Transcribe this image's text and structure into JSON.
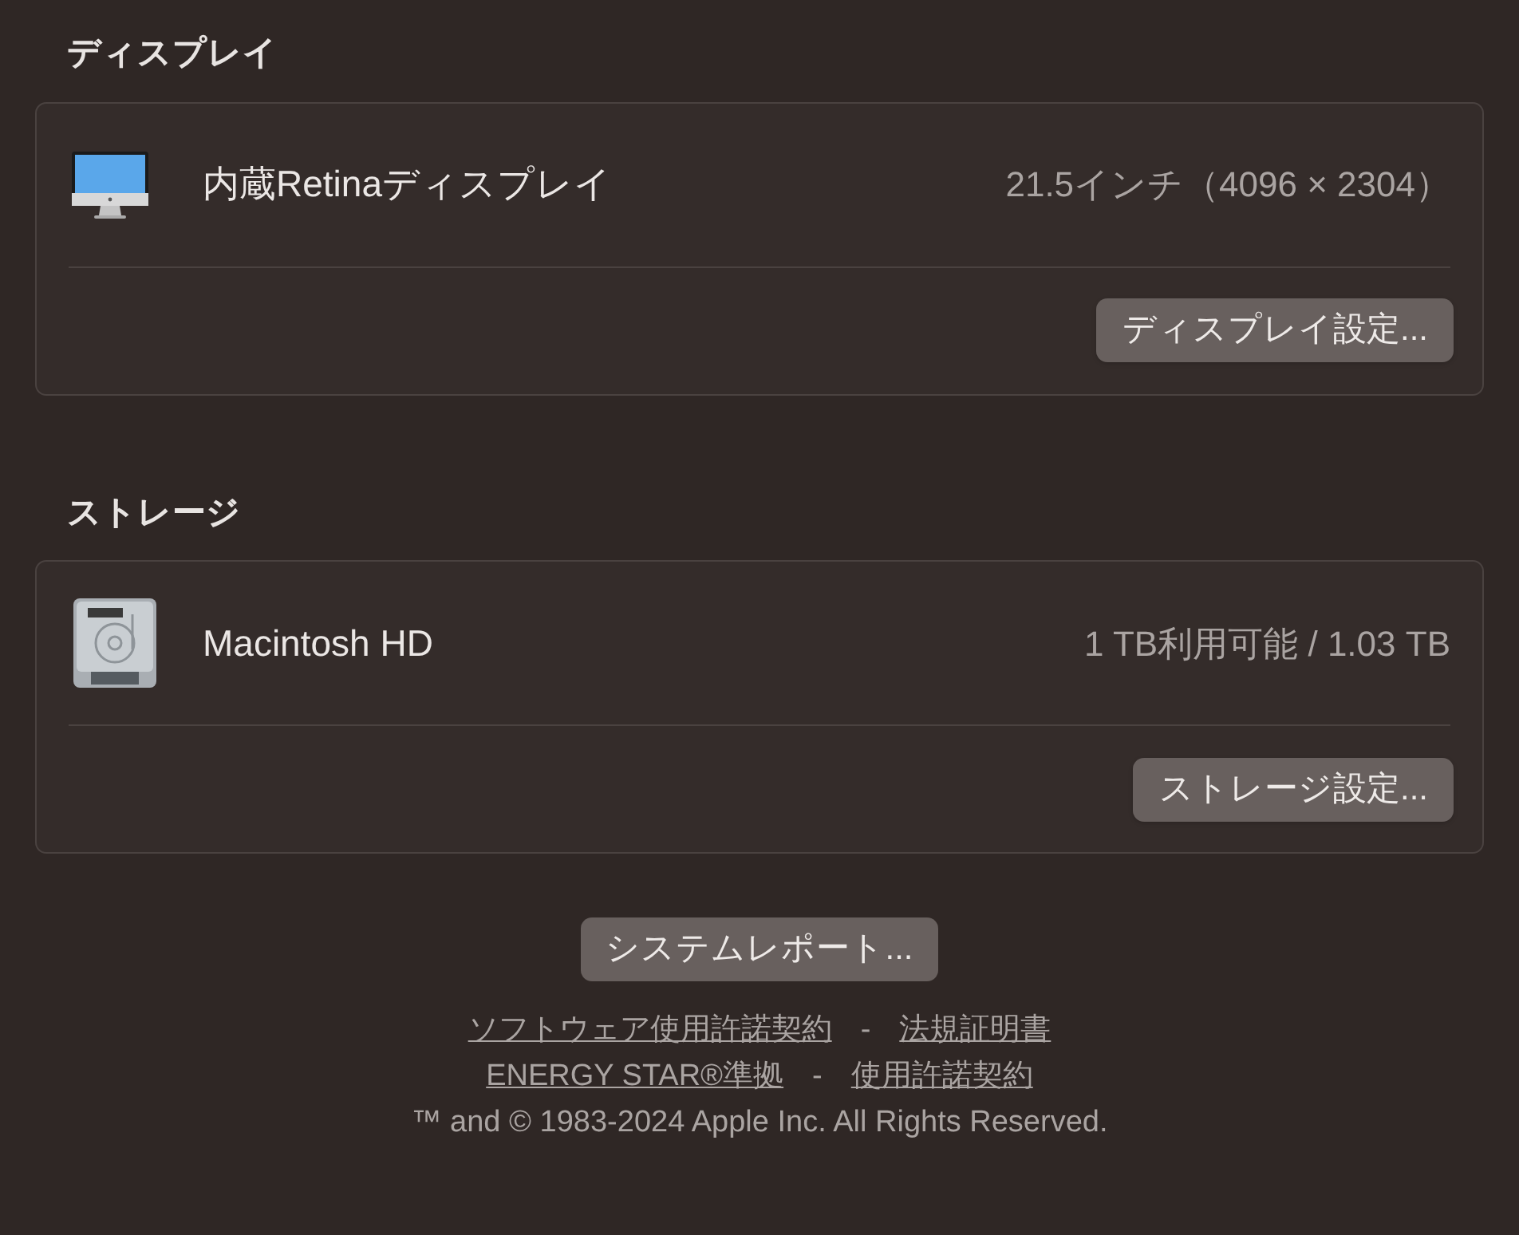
{
  "sections": [
    {
      "title": "ディスプレイ",
      "kind": "display",
      "name": "内蔵Retinaディスプレイ",
      "detail": "21.5インチ（4096 × 2304）",
      "button": "ディスプレイ設定..."
    },
    {
      "title": "ストレージ",
      "kind": "storage",
      "name": "Macintosh HD",
      "detail": "1 TB利用可能 / 1.03 TB",
      "button": "ストレージ設定..."
    }
  ],
  "report_button": "システムレポート...",
  "links": [
    [
      "ソフトウェア使用許諾契約",
      "法規証明書"
    ],
    [
      "ENERGY STAR®準拠",
      "使用許諾契約"
    ]
  ],
  "separator": "-",
  "copyright": "™ and © 1983-2024 Apple Inc. All Rights Reserved."
}
